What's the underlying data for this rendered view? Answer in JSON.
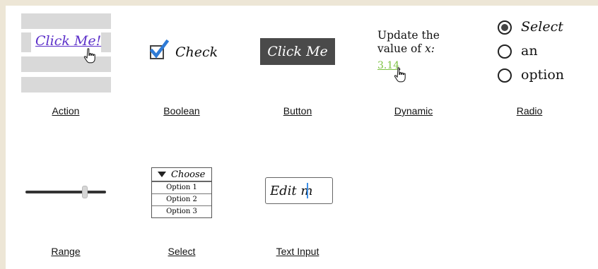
{
  "action": {
    "link_label": "Click Me!",
    "caption": "Action"
  },
  "boolean": {
    "label": "Check",
    "checked": true,
    "caption": "Boolean"
  },
  "button": {
    "label": "Click Me",
    "caption": "Button"
  },
  "dynamic": {
    "text_line1": "Update the",
    "text_line2_prefix": "value of ",
    "variable": "x:",
    "value": "3.14",
    "trailing": ".",
    "caption": "Dynamic"
  },
  "radio": {
    "options": [
      {
        "label": "Select",
        "selected": true
      },
      {
        "label": "an",
        "selected": false
      },
      {
        "label": "option",
        "selected": false
      }
    ],
    "caption": "Radio"
  },
  "range": {
    "value_fraction": 0.73,
    "caption": "Range"
  },
  "select": {
    "selected": "Choose",
    "options": [
      "Option 1",
      "Option 2",
      "Option 3"
    ],
    "caption": "Select"
  },
  "text_input": {
    "value": "Edit m",
    "caption": "Text Input"
  },
  "colors": {
    "link": "#5b2fc9",
    "value_green": "#7dc242",
    "checkbox_blue": "#2e7bd6",
    "dark_button": "#4a4a4a"
  },
  "icons": [
    "hand-pointer-icon",
    "checkmark-icon",
    "chevron-down-icon"
  ]
}
